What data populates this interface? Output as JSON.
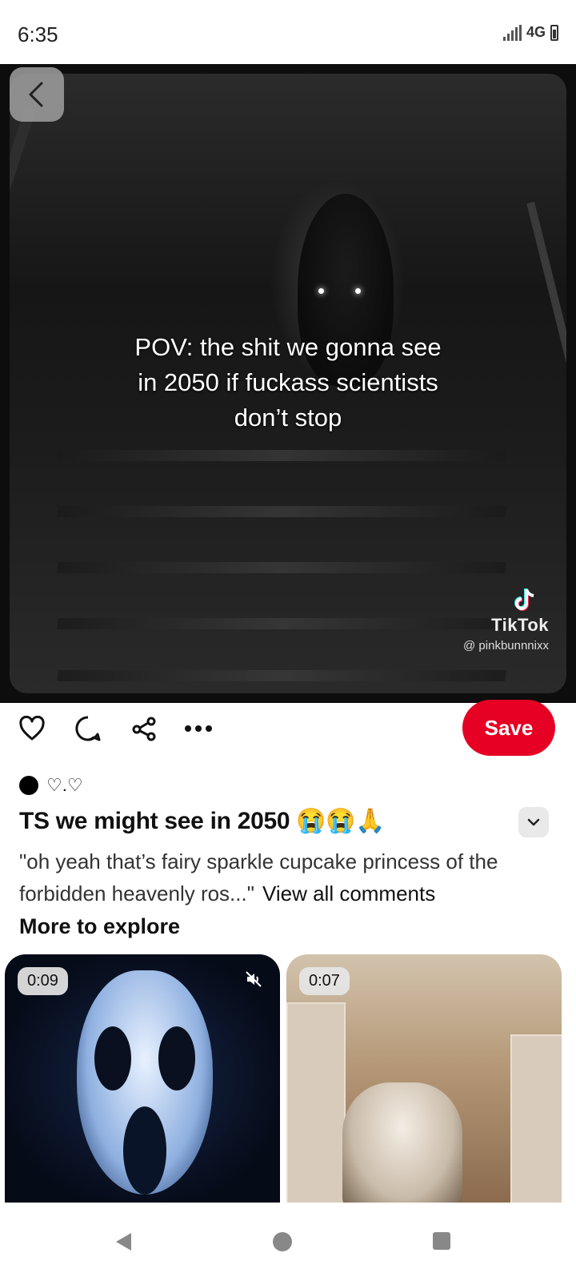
{
  "status_bar": {
    "time": "6:35",
    "network": "4G"
  },
  "pin": {
    "caption": "POV: the shit we gonna see\nin 2050 if fuckass scientists\ndon’t stop",
    "watermark": {
      "brand": "TikTok",
      "handle": "@ pinkbunnnixx"
    }
  },
  "actions": {
    "save_label": "Save"
  },
  "author": {
    "name": "♡.♡"
  },
  "title": {
    "text": "TS we might see in 2050",
    "emojis": "😭😭🙏"
  },
  "comment": {
    "preview": "\"oh yeah that’s fairy sparkle cupcake princess of the forbidden heavenly ros...\"",
    "view_all": "View all comments"
  },
  "more_to_explore": {
    "heading": "More to explore",
    "cards": [
      {
        "duration": "0:09",
        "muted": true
      },
      {
        "duration": "0:07"
      }
    ]
  },
  "colors": {
    "save_button": "#e60023",
    "background": "#ffffff"
  }
}
